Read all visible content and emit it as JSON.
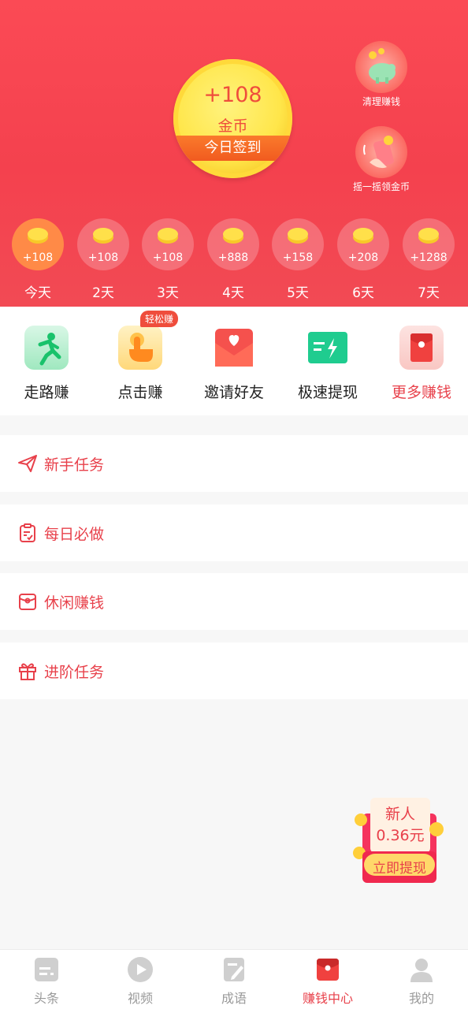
{
  "checkin": {
    "amount": "+108",
    "unit": "金币",
    "button": "今日签到"
  },
  "side_actions": [
    {
      "label": "清理赚钱",
      "icon": "piggy-bank-icon"
    },
    {
      "label": "摇一摇领金币",
      "icon": "shake-phone-icon"
    }
  ],
  "days": [
    {
      "amount": "+108",
      "label": "今天"
    },
    {
      "amount": "+108",
      "label": "2天"
    },
    {
      "amount": "+108",
      "label": "3天"
    },
    {
      "amount": "+888",
      "label": "4天"
    },
    {
      "amount": "+158",
      "label": "5天"
    },
    {
      "amount": "+208",
      "label": "6天"
    },
    {
      "amount": "+1288",
      "label": "7天"
    }
  ],
  "shortcuts": [
    {
      "label": "走路赚",
      "icon": "running-man-icon"
    },
    {
      "label": "点击赚",
      "icon": "tap-hand-icon",
      "badge": "轻松赚"
    },
    {
      "label": "邀请好友",
      "icon": "heart-envelope-icon"
    },
    {
      "label": "极速提现",
      "icon": "fast-withdraw-icon"
    },
    {
      "label": "更多赚钱",
      "icon": "red-packet-icon"
    }
  ],
  "tasks": [
    {
      "label": "新手任务",
      "icon": "paper-plane-icon"
    },
    {
      "label": "每日必做",
      "icon": "clipboard-icon"
    },
    {
      "label": "休闲赚钱",
      "icon": "wallet-icon"
    },
    {
      "label": "进阶任务",
      "icon": "gift-icon"
    }
  ],
  "float_promo": {
    "title": "新人",
    "amount": "0.36元",
    "button": "立即提现"
  },
  "tabbar": [
    {
      "label": "头条",
      "icon": "news-icon",
      "active": false
    },
    {
      "label": "视频",
      "icon": "play-icon",
      "active": false
    },
    {
      "label": "成语",
      "icon": "pencil-note-icon",
      "active": false
    },
    {
      "label": "赚钱中心",
      "icon": "red-packet-icon",
      "active": true
    },
    {
      "label": "我的",
      "icon": "person-icon",
      "active": false
    }
  ],
  "colors": {
    "header_red": "#f4414e",
    "accent": "#e8414b",
    "coin_gold": "#ffe64a",
    "ribbon_orange": "#f15b1f"
  }
}
